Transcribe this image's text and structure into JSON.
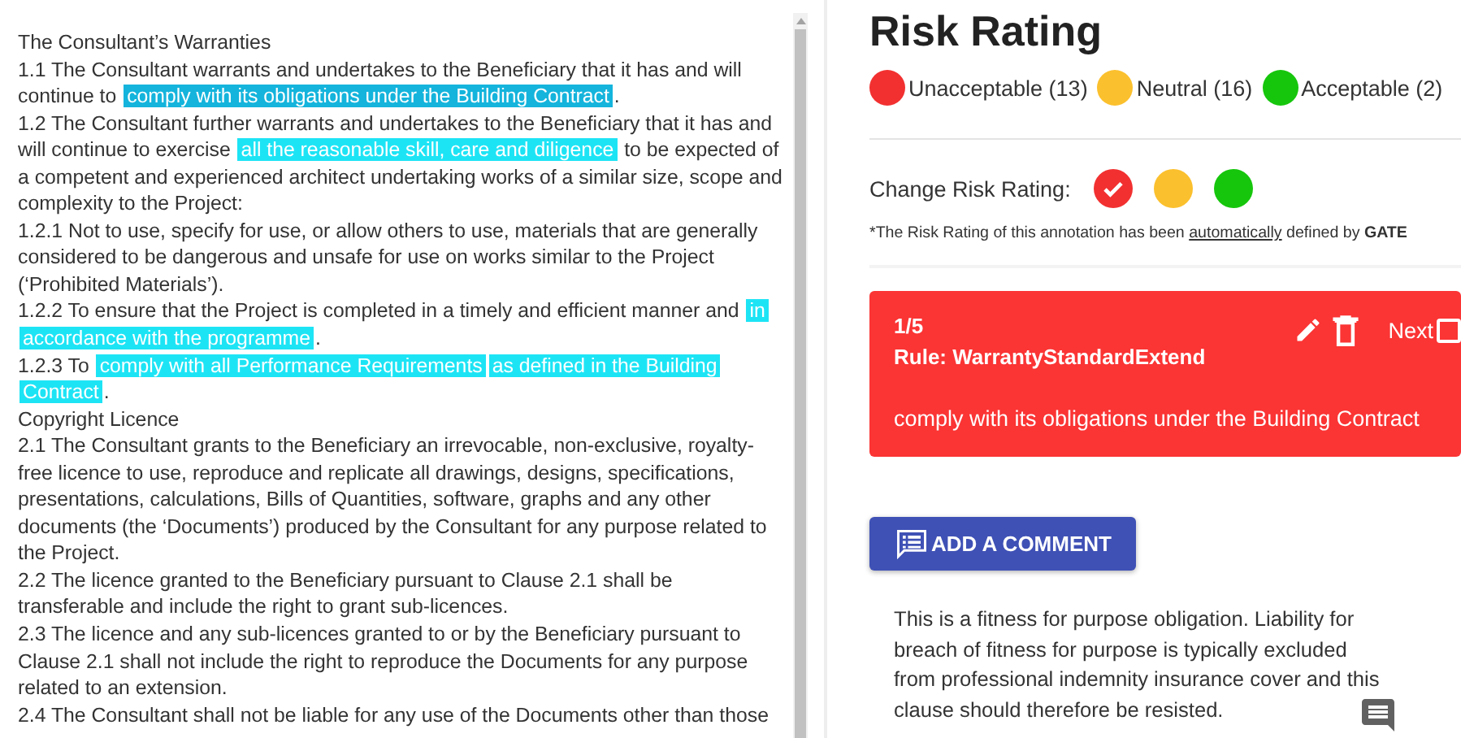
{
  "document": {
    "paragraphs": [
      [
        {
          "kind": "plain",
          "text": "The Consultant’s Warranties"
        }
      ],
      [
        {
          "kind": "plain",
          "text": "1.1 The Consultant warrants and undertakes to the Beneficiary that it has and will continue to "
        },
        {
          "kind": "highlight",
          "text": "comply with its obligations under the Building Contract",
          "selected": true
        },
        {
          "kind": "plain",
          "text": "."
        }
      ],
      [
        {
          "kind": "plain",
          "text": "1.2 The Consultant further warrants and undertakes to the Beneficiary that it has and will continue to exercise "
        },
        {
          "kind": "highlight",
          "text": "all the reasonable skill, care and diligence",
          "selected": false
        },
        {
          "kind": "plain",
          "text": " to be expected of a competent and experienced architect undertaking works of a similar size, scope and complexity to the Project:"
        }
      ],
      [
        {
          "kind": "plain",
          "text": "1.2.1 Not to use, specify for use, or allow others to use, materials that are generally considered to be dangerous and unsafe for use on works similar to the Project (‘Prohibited Materials’)."
        }
      ],
      [
        {
          "kind": "plain",
          "text": "1.2.2 To ensure that the Project is completed in a timely and efficient manner and "
        },
        {
          "kind": "highlight",
          "text": "in",
          "selected": false
        },
        {
          "kind": "highlight",
          "text": "accordance with the programme",
          "selected": false
        },
        {
          "kind": "plain",
          "text": "."
        }
      ],
      [
        {
          "kind": "plain",
          "text": "1.2.3 To "
        },
        {
          "kind": "highlight",
          "text": "comply with all Performance Requirements",
          "selected": false
        },
        {
          "kind": "highlight",
          "text": "as defined in the Building",
          "selected": false
        },
        {
          "kind": "highlight",
          "text": "Contract",
          "selected": false
        },
        {
          "kind": "plain",
          "text": "."
        }
      ],
      [
        {
          "kind": "plain",
          "text": "Copyright Licence"
        }
      ],
      [
        {
          "kind": "plain",
          "text": "2.1 The Consultant grants to the Beneficiary an irrevocable, non-exclusive, royalty-free licence to use, reproduce and replicate all drawings, designs, specifications, presentations, calculations, Bills of Quantities, software, graphs and any other documents (the ‘Documents’) produced by the Consultant for any purpose related to the Project."
        }
      ],
      [
        {
          "kind": "plain",
          "text": "2.2 The licence granted to the Beneficiary pursuant to Clause 2.1 shall be transferable and include the right to grant sub-licences."
        }
      ],
      [
        {
          "kind": "plain",
          "text": "2.3 The licence and any sub-licences granted to or by the Beneficiary pursuant to Clause 2.1 shall not include the right to reproduce the Documents for any purpose related to an extension."
        }
      ],
      [
        {
          "kind": "plain",
          "text": "2.4 The Consultant shall not be liable for any use of the Documents other than those"
        }
      ]
    ]
  },
  "panel": {
    "title": "Risk Rating",
    "legend": [
      {
        "label": "Unacceptable (13)",
        "color": "#f23030"
      },
      {
        "label": "Neutral (16)",
        "color": "#fbc02d"
      },
      {
        "label": "Acceptable (2)",
        "color": "#16c60c"
      }
    ],
    "change_label": "Change Risk Rating:",
    "ratings": [
      {
        "color": "#f23030",
        "selected": true
      },
      {
        "color": "#fbc02d",
        "selected": false
      },
      {
        "color": "#16c60c",
        "selected": false
      }
    ],
    "note": {
      "before": "*The Risk Rating of this annotation has been ",
      "link": "automatically",
      "after": " defined by **GATE**"
    },
    "annotation": {
      "counter": "1/5",
      "rule": "Rule: WarrantyStandardExtend",
      "next_label": "Next",
      "next_checked": false,
      "text": "comply with its obligations under the Building Contract"
    },
    "add_comment": "ADD A COMMENT",
    "comment": "This is a fitness for purpose obligation. Liability for breach of fitness for purpose is typically excluded from professional indemnity insurance cover and this clause should therefore be resisted."
  }
}
